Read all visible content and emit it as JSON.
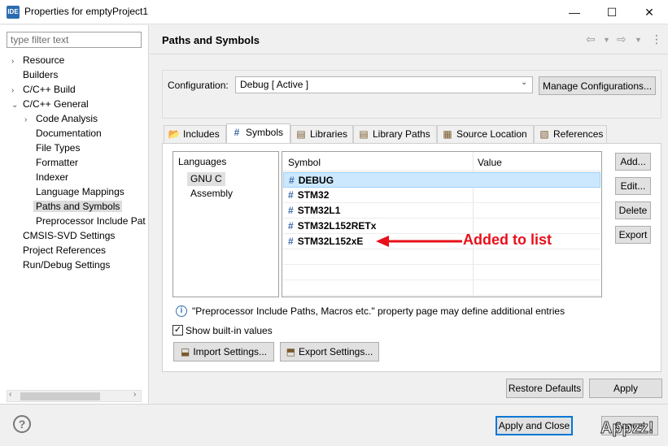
{
  "window": {
    "app_icon_text": "IDE",
    "title": "Properties for emptyProject1",
    "minimize": "—",
    "maximize": "☐",
    "close": "✕"
  },
  "sidebar": {
    "filter_placeholder": "type filter text",
    "items": [
      {
        "label": "Resource",
        "expander": "›",
        "level": 0
      },
      {
        "label": "Builders",
        "expander": "",
        "level": 0
      },
      {
        "label": "C/C++ Build",
        "expander": "›",
        "level": 0
      },
      {
        "label": "C/C++ General",
        "expander": "⌄",
        "level": 0
      },
      {
        "label": "Code Analysis",
        "expander": "›",
        "level": 1
      },
      {
        "label": "Documentation",
        "expander": "",
        "level": 1
      },
      {
        "label": "File Types",
        "expander": "",
        "level": 1
      },
      {
        "label": "Formatter",
        "expander": "",
        "level": 1
      },
      {
        "label": "Indexer",
        "expander": "",
        "level": 1
      },
      {
        "label": "Language Mappings",
        "expander": "",
        "level": 1
      },
      {
        "label": "Paths and Symbols",
        "expander": "",
        "level": 1,
        "selected": true
      },
      {
        "label": "Preprocessor Include Pat",
        "expander": "",
        "level": 1
      },
      {
        "label": "CMSIS-SVD Settings",
        "expander": "",
        "level": 0
      },
      {
        "label": "Project References",
        "expander": "",
        "level": 0
      },
      {
        "label": "Run/Debug Settings",
        "expander": "",
        "level": 0
      }
    ],
    "scroll_left": "‹",
    "scroll_right": "›"
  },
  "page": {
    "title": "Paths and Symbols",
    "configuration_label": "Configuration:",
    "configuration_value": "Debug  [ Active ]",
    "manage_button": "Manage Configurations..."
  },
  "tabs": [
    {
      "label": "Includes",
      "icon": "📂",
      "active": false
    },
    {
      "label": "Symbols",
      "icon": "#",
      "active": true
    },
    {
      "label": "Libraries",
      "icon": "▤",
      "active": false
    },
    {
      "label": "Library Paths",
      "icon": "▤",
      "active": false
    },
    {
      "label": "Source Location",
      "icon": "▦",
      "active": false
    },
    {
      "label": "References",
      "icon": "▧",
      "active": false
    }
  ],
  "languages": {
    "title": "Languages",
    "items": [
      "GNU C",
      "Assembly"
    ]
  },
  "symbols_table": {
    "col_symbol": "Symbol",
    "col_value": "Value",
    "rows": [
      {
        "symbol": "DEBUG",
        "value": "",
        "selected": true
      },
      {
        "symbol": "STM32",
        "value": ""
      },
      {
        "symbol": "STM32L1",
        "value": ""
      },
      {
        "symbol": "STM32L152RETx",
        "value": ""
      },
      {
        "symbol": "STM32L152xE",
        "value": ""
      }
    ]
  },
  "annotation": {
    "text": "Added to list",
    "color": "#e8101a"
  },
  "side_buttons": {
    "add": "Add...",
    "edit": "Edit...",
    "delete": "Delete",
    "export": "Export"
  },
  "info_text": "\"Preprocessor Include Paths, Macros etc.\" property page may define additional entries",
  "show_builtin": {
    "label": "Show built-in values",
    "checked": true
  },
  "import_button": "Import Settings...",
  "export_button": "Export Settings...",
  "restore_defaults": "Restore Defaults",
  "apply": "Apply",
  "apply_and_close": "Apply and Close",
  "cancel": "Cancel",
  "watermark": "Appzz!"
}
